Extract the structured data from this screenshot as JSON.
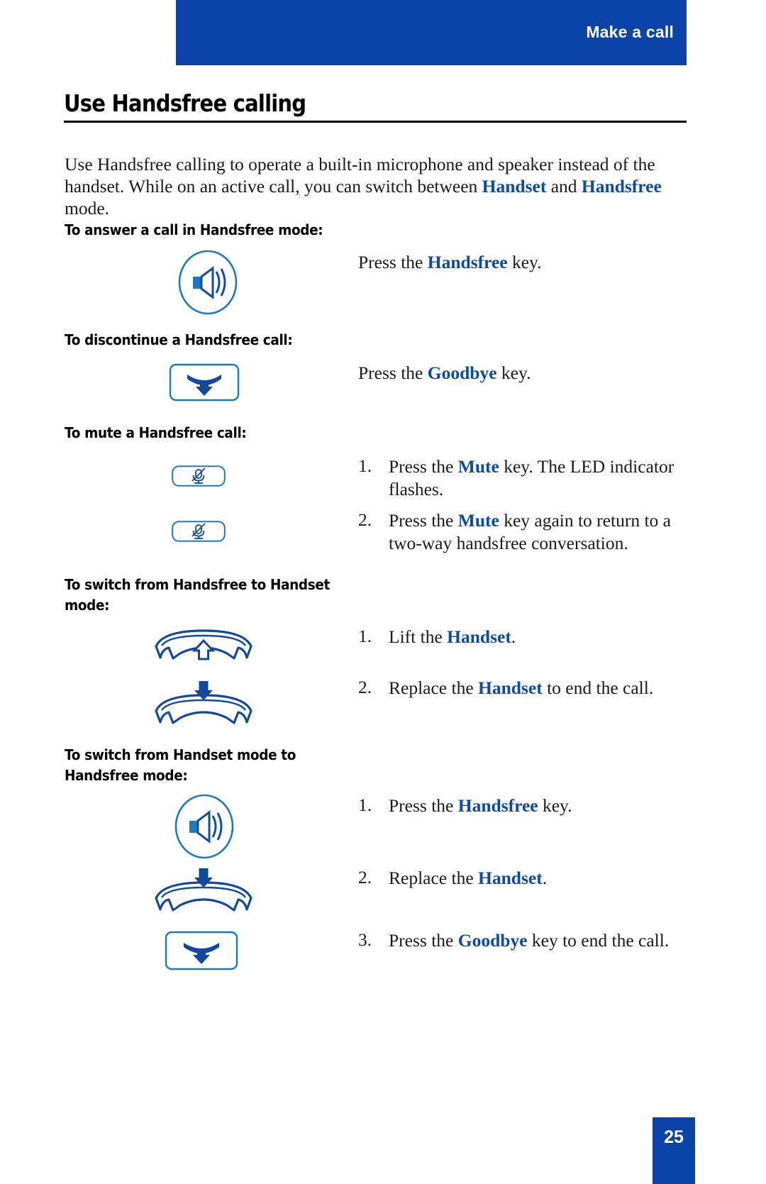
{
  "header": {
    "title": "Make a call",
    "bar_color": "#0a44a8"
  },
  "page_title": "Use Handsfree calling",
  "intro": {
    "part1": "Use Handsfree calling to operate a built-in microphone and speaker instead of the handset. While on an active call, you can switch between ",
    "kw1": "Handset",
    "part2": " and ",
    "kw2": "Handsfree",
    "part3": " mode."
  },
  "sections": [
    {
      "heading": "To answer a call in Handsfree mode:",
      "icons": [
        "handsfree-speaker-icon"
      ],
      "steps": [
        {
          "num": "",
          "pre": "Press the ",
          "kw": "Handsfree",
          "post": " key."
        }
      ]
    },
    {
      "heading": "To discontinue a Handsfree call:",
      "icons": [
        "goodbye-key-icon"
      ],
      "steps": [
        {
          "num": "",
          "pre": "Press the ",
          "kw": "Goodbye",
          "post": " key."
        }
      ]
    },
    {
      "heading": "To mute a Handsfree call:",
      "icons": [
        "mute-key-icon",
        "mute-key-icon"
      ],
      "steps": [
        {
          "num": "1.",
          "pre": "Press the ",
          "kw": "Mute",
          "post": " key. The LED indicator flashes."
        },
        {
          "num": "2.",
          "pre": "Press the ",
          "kw": "Mute",
          "post": " key again to return to a two-way handsfree conversation."
        }
      ]
    },
    {
      "heading": "To switch from Handsfree to Handset mode:",
      "icons": [
        "lift-handset-icon",
        "replace-handset-icon"
      ],
      "steps": [
        {
          "num": "1.",
          "pre": "Lift the ",
          "kw": "Handset",
          "post": "."
        },
        {
          "num": "2.",
          "pre": "Replace the ",
          "kw": "Handset",
          "post": " to end the call."
        }
      ]
    },
    {
      "heading": "To switch from Handset mode to Handsfree mode:",
      "icons": [
        "handsfree-speaker-icon",
        "replace-handset-icon",
        "goodbye-key-icon"
      ],
      "steps": [
        {
          "num": "1.",
          "pre": "Press the ",
          "kw": "Handsfree",
          "post": " key."
        },
        {
          "num": "2.",
          "pre": "Replace the ",
          "kw": "Handset",
          "post": "."
        },
        {
          "num": "3.",
          "pre": "Press the ",
          "kw": "Goodbye",
          "post": " key to end the call."
        }
      ]
    }
  ],
  "page_number": "25",
  "colors": {
    "accent_blue": "#0a44a8",
    "keyword_blue": "#0b4ba8",
    "icon_blue": "#1b66b3",
    "icon_dark_blue": "#12489e"
  }
}
